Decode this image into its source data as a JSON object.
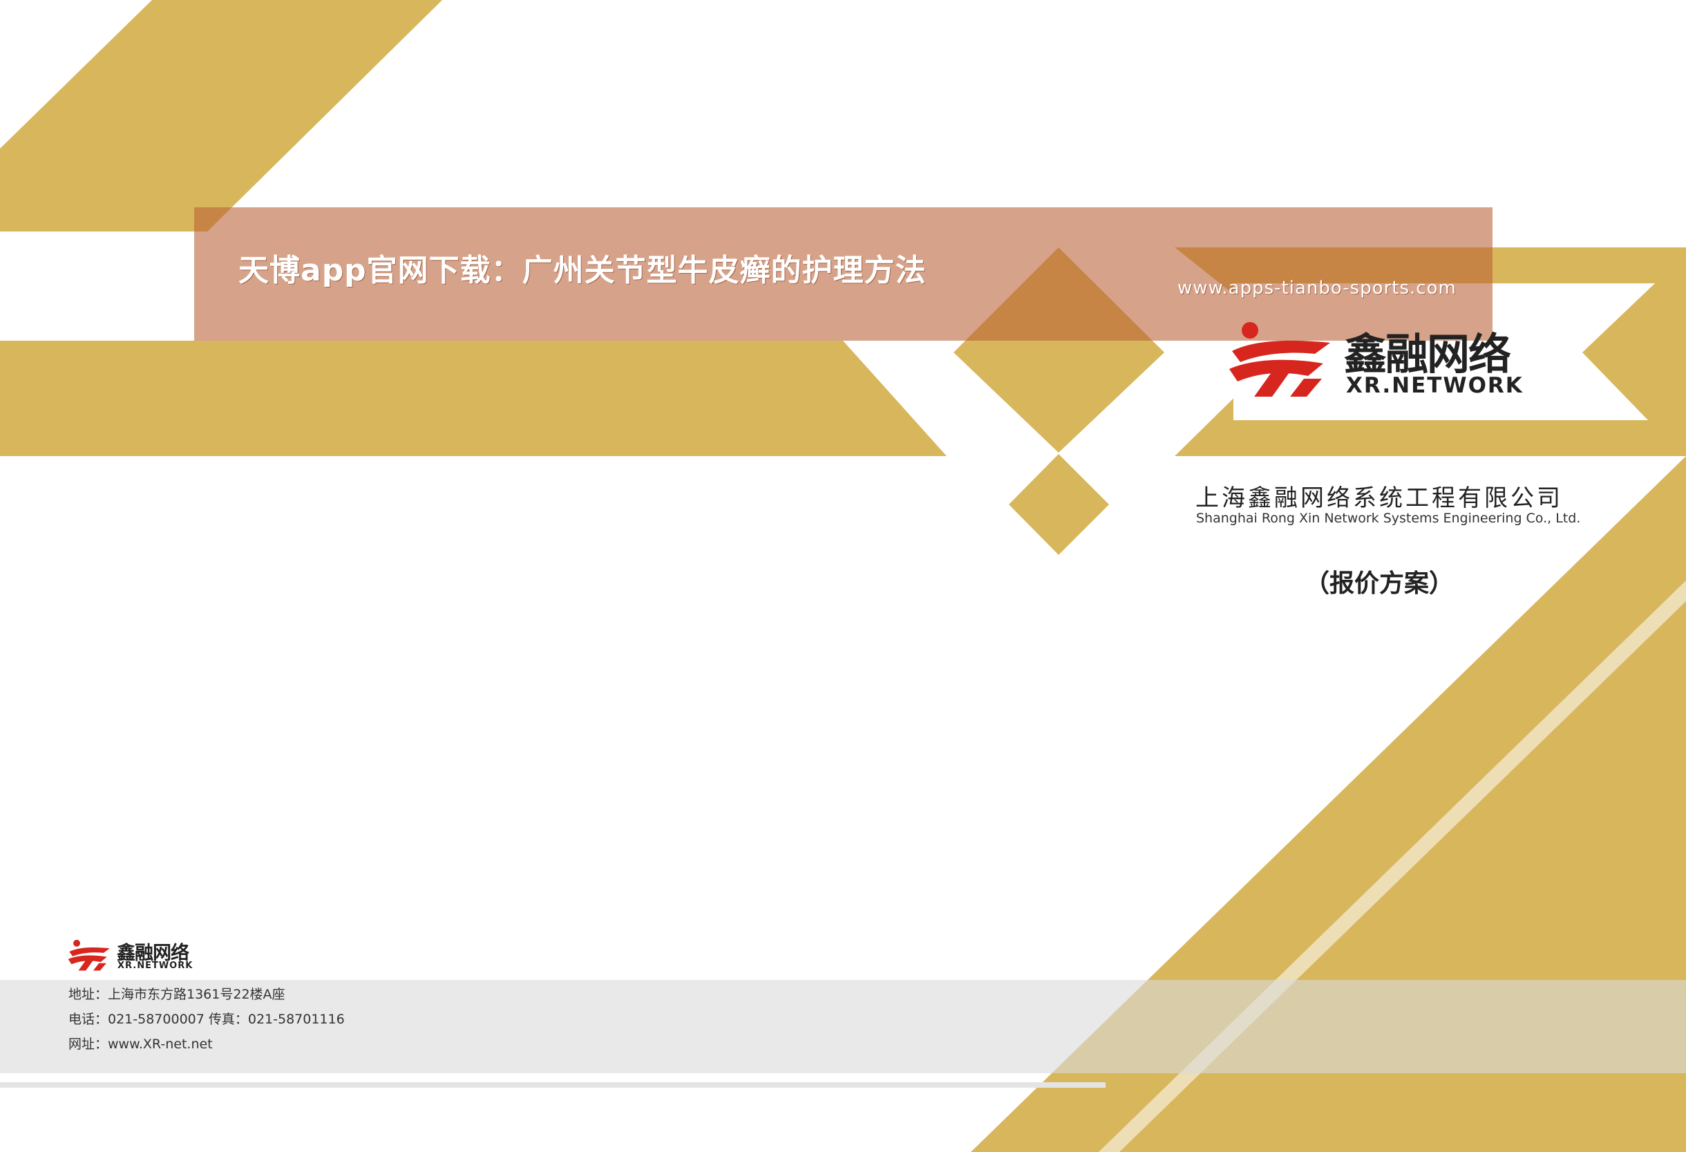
{
  "banner": {
    "title": "天博app官网下载：广州关节型牛皮癣的护理方法",
    "url": "www.apps-tianbo-sports.com"
  },
  "logo": {
    "cn": "鑫融网络",
    "en": "XR.NETWORK"
  },
  "company": {
    "name_cn": "上海鑫融网络系统工程有限公司",
    "name_en": "Shanghai Rong Xin Network Systems Engineering Co., Ltd."
  },
  "document": {
    "subtitle": "（报价方案）"
  },
  "footer": {
    "logo_cn": "鑫融网络",
    "logo_en": "XR.NETWORK",
    "address": "地址：上海市东方路1361号22楼A座",
    "phone": "电话：021-58700007  传真：021-58701116",
    "website": "网址：www.XR-net.net"
  },
  "colors": {
    "gold": "#D8B65C",
    "banner": "#B86036",
    "logo_red": "#D7261E"
  }
}
